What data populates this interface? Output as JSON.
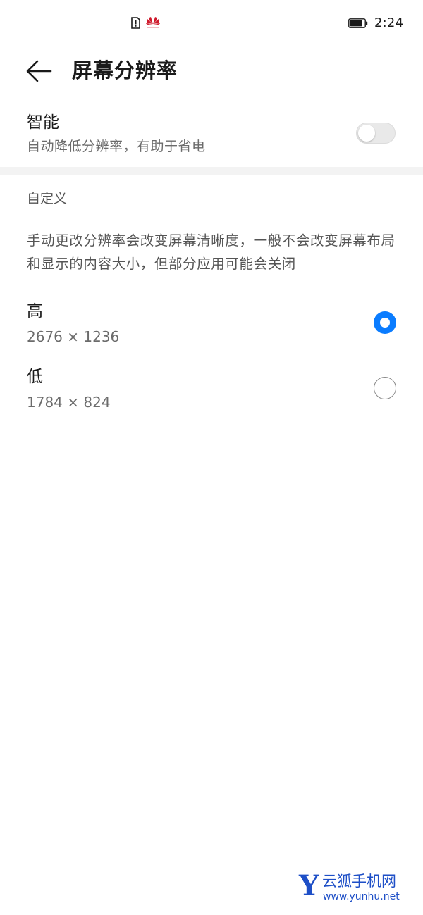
{
  "status_bar": {
    "time": "2:24",
    "sim_icon": "sim-alert-icon",
    "brand_icon": "huawei-logo-icon",
    "battery_icon": "battery-icon"
  },
  "header": {
    "back_icon": "arrow-left-icon",
    "title": "屏幕分辨率"
  },
  "smart": {
    "title": "智能",
    "subtitle": "自动降低分辨率，有助于省电",
    "enabled": false
  },
  "custom": {
    "section_title": "自定义",
    "description": "手动更改分辨率会改变屏幕清晰度，一般不会改变屏幕布局和显示的内容大小，但部分应用可能会关闭",
    "options": [
      {
        "label": "高",
        "value": "2676 × 1236",
        "selected": true
      },
      {
        "label": "低",
        "value": "1784 × 824",
        "selected": false
      }
    ]
  },
  "watermark": {
    "letter": "Y",
    "name": "云狐手机网",
    "url": "www.yunhu.net"
  },
  "colors": {
    "accent": "#0a7cff",
    "watermark": "#1e4fc7"
  }
}
